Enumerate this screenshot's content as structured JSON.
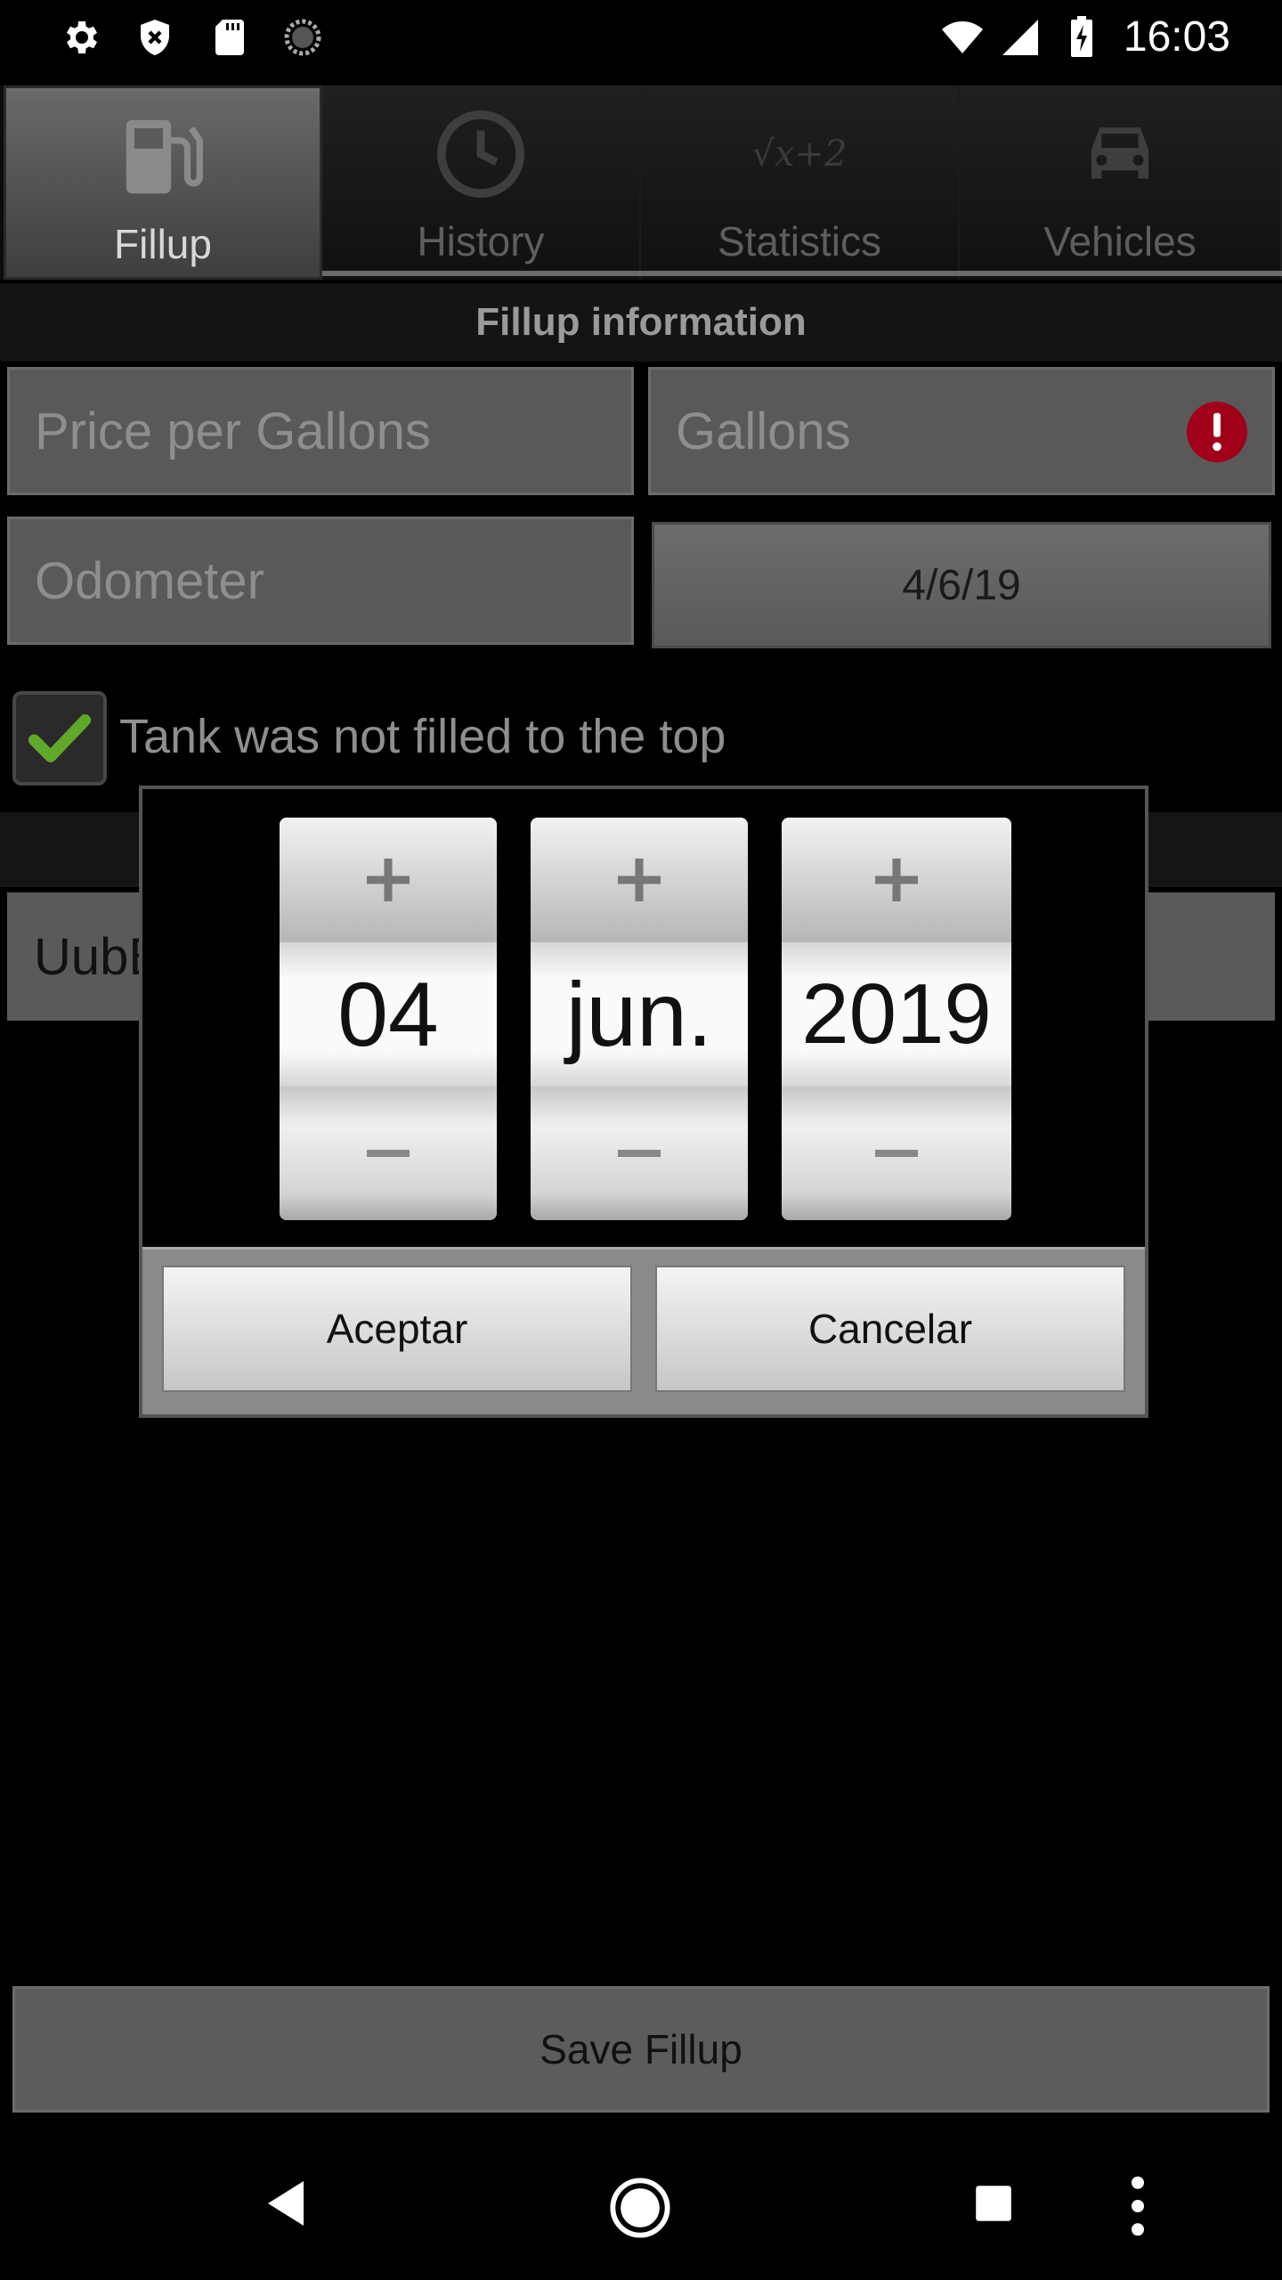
{
  "status_bar": {
    "time": "16:03",
    "icons": [
      "settings-icon",
      "shield-x-icon",
      "sd-card-icon",
      "sync-icon",
      "wifi-icon",
      "signal-icon",
      "battery-charging-icon"
    ]
  },
  "tabs": [
    {
      "label": "Fillup",
      "icon": "fuel-pump-icon",
      "active": true
    },
    {
      "label": "History",
      "icon": "clock-icon",
      "active": false
    },
    {
      "label": "Statistics",
      "icon": "formula-icon",
      "active": false
    },
    {
      "label": "Vehicles",
      "icon": "car-icon",
      "active": false
    }
  ],
  "statistics_icon_text": "√x+2",
  "section_title": "Fillup information",
  "form": {
    "price_placeholder": "Price per Gallons",
    "gallons_placeholder": "Gallons",
    "odometer_placeholder": "Odometer",
    "date_value": "4/6/19",
    "checkbox_label": "Tank was not filled to the top",
    "checkbox_checked": true,
    "vehicle_value": "UubBas"
  },
  "date_picker": {
    "day": "04",
    "month": "jun.",
    "year": "2019",
    "plus_glyph": "+",
    "minus_glyph": "–"
  },
  "dialog_buttons": {
    "accept": "Aceptar",
    "cancel": "Cancelar"
  },
  "save_button": "Save Fillup",
  "colors": {
    "alert_red": "#a00018",
    "check_green": "#5fa82a"
  }
}
